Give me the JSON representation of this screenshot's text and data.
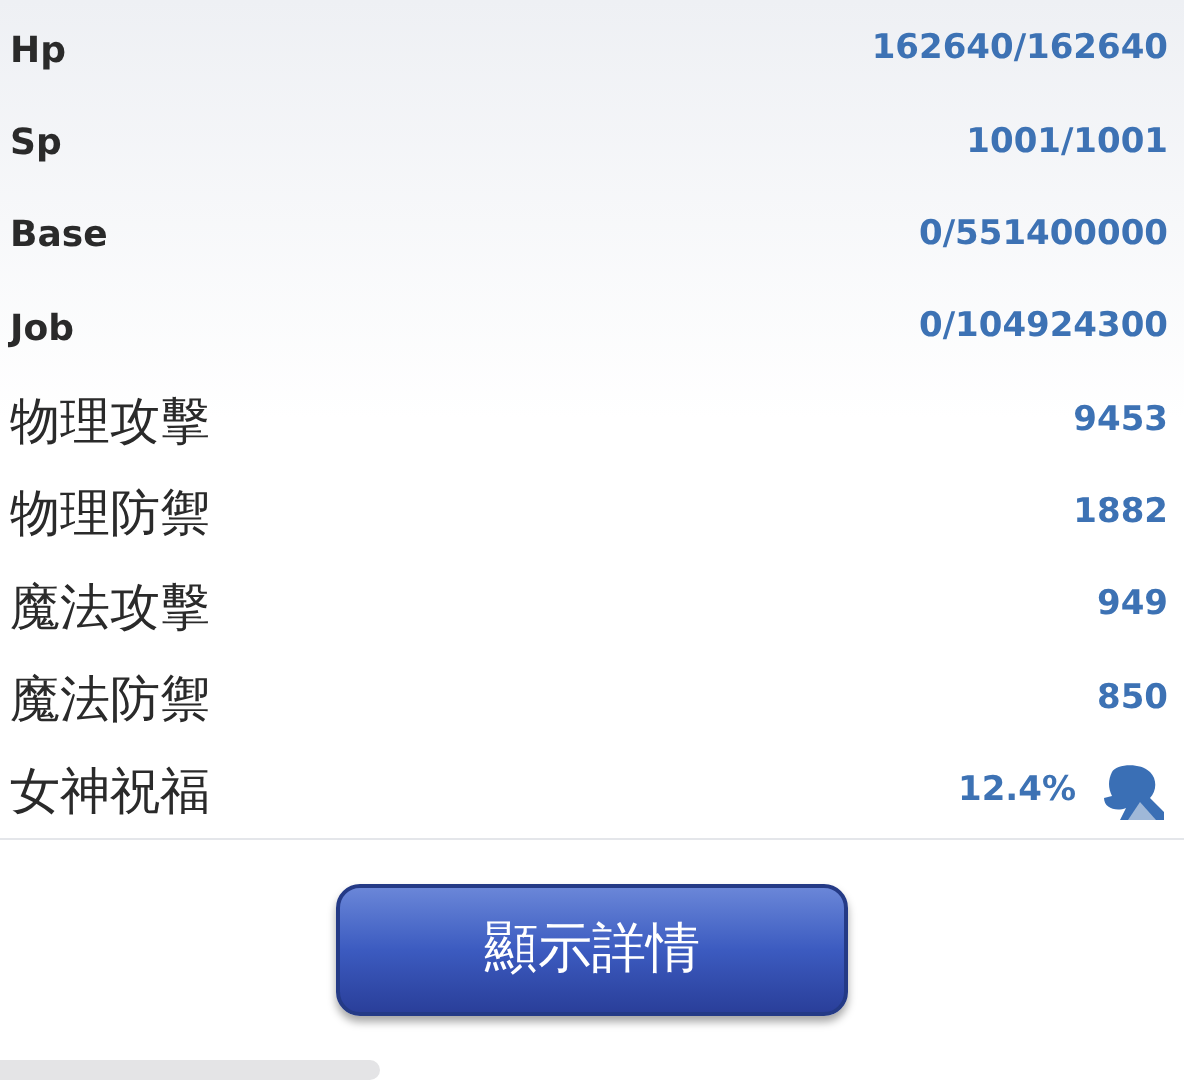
{
  "stats": [
    {
      "kind": "counter",
      "label": "Hp",
      "value": "162640/162640"
    },
    {
      "kind": "counter",
      "label": "Sp",
      "value": "1001/1001"
    },
    {
      "kind": "counter",
      "label": "Base",
      "value": "0/551400000"
    },
    {
      "kind": "counter",
      "label": "Job",
      "value": "0/104924300"
    },
    {
      "kind": "attribute",
      "label": "物理攻擊",
      "value": "9453"
    },
    {
      "kind": "attribute",
      "label": "物理防禦",
      "value": "1882"
    },
    {
      "kind": "attribute",
      "label": "魔法攻擊",
      "value": "949"
    },
    {
      "kind": "attribute",
      "label": "魔法防禦",
      "value": "850"
    },
    {
      "kind": "blessing",
      "label": "女神祝福",
      "value": "12.4%"
    }
  ],
  "details_button": {
    "label": "顯示詳情"
  }
}
